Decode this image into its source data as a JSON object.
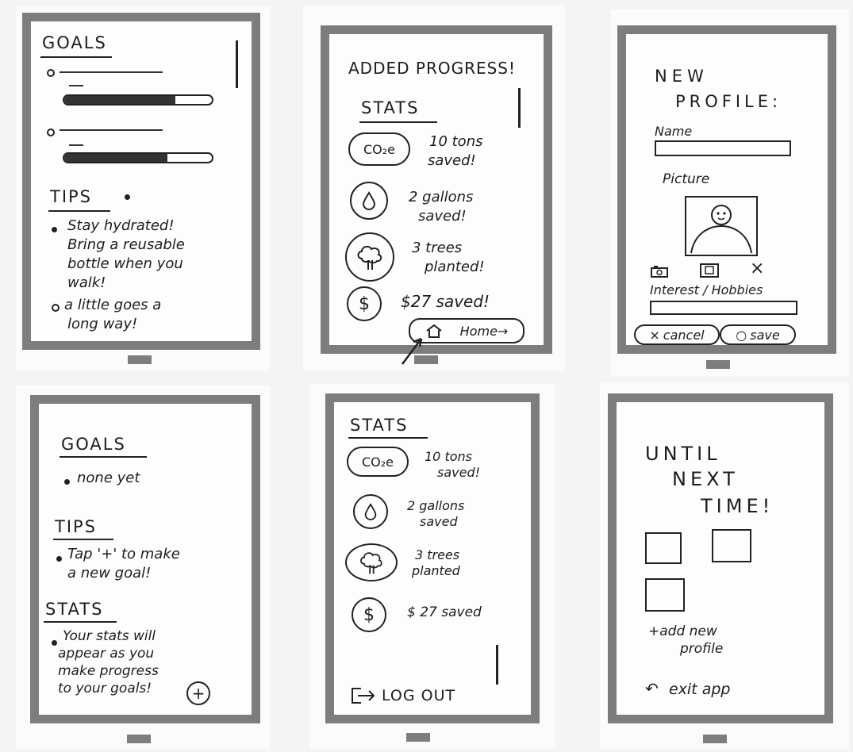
{
  "screens": {
    "goals_tips": {
      "goals_title": "GOALS",
      "tips_title": "TIPS",
      "tip_1": [
        "Stay hydrated!",
        "Bring a reusable",
        "bottle when you",
        "walk!"
      ],
      "tip_2": [
        "a little goes a",
        "long way!"
      ],
      "goal_1_progress": 0.75,
      "goal_2_progress": 0.7
    },
    "added_progress": {
      "title": "ADDED PROGRESS!",
      "stats_title": "STATS",
      "co2_icon": "CO₂e",
      "stat_1": [
        "10 tons",
        "saved!"
      ],
      "stat_2": [
        "2 gallons",
        "saved!"
      ],
      "stat_3": [
        "3 trees",
        "planted!"
      ],
      "stat_4": "$27 saved!",
      "home_button": "Home"
    },
    "new_profile": {
      "title_1": "NEW",
      "title_2": "PROFILE:",
      "name_label": "Name",
      "picture_label": "Picture",
      "interests_label": "Interest / Hobbies",
      "cancel_label": "cancel",
      "save_label": "save",
      "remove_glyph": "×"
    },
    "empty_goals": {
      "goals_title": "GOALS",
      "goals_item": "none yet",
      "tips_title": "TIPS",
      "tips_item": [
        "Tap '+' to make",
        "a new goal!"
      ],
      "stats_title": "STATS",
      "stats_item": [
        "Your stats will",
        "appear as you",
        "make progress",
        "to your goals!"
      ],
      "add_glyph": "+"
    },
    "stats_logout": {
      "stats_title": "STATS",
      "co2_icon": "CO₂e",
      "stat_1": [
        "10 tons",
        "saved!"
      ],
      "stat_2": [
        "2 gallons",
        "saved"
      ],
      "stat_3": [
        "3 trees",
        "planted"
      ],
      "stat_4": "$ 27 saved",
      "logout_label": "LOG OUT"
    },
    "until_next_time": {
      "title_1": "UNTIL",
      "title_2": "NEXT",
      "title_3": "TIME!",
      "add_profile": [
        "+add new",
        "profile"
      ],
      "exit_label": "exit app"
    }
  },
  "icons": {
    "drop": "drop-icon",
    "tree": "tree-icon",
    "dollar": "dollar-icon",
    "home": "home-icon",
    "camera": "camera-icon",
    "gallery": "gallery-icon",
    "logout": "logout-icon",
    "exit": "exit-icon"
  },
  "colors": {
    "frame": "#7d7d7d",
    "ink": "#1d1d1d",
    "paper": "#fdfdfd"
  }
}
